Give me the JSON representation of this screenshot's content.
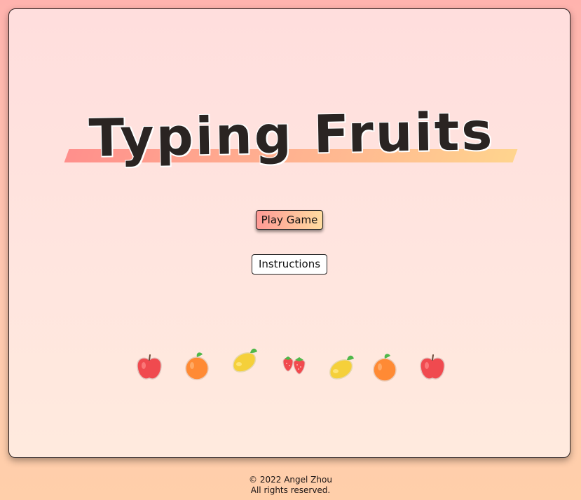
{
  "title": "Typing Fruits",
  "buttons": {
    "play": "Play Game",
    "instructions": "Instructions"
  },
  "fruits": [
    {
      "icon": "apple-icon"
    },
    {
      "icon": "orange-icon"
    },
    {
      "icon": "mango-icon"
    },
    {
      "icon": "strawberry-icon"
    },
    {
      "icon": "mango-icon"
    },
    {
      "icon": "orange-icon"
    },
    {
      "icon": "apple-icon"
    }
  ],
  "footer": {
    "copyright": "© 2022 Angel Zhou",
    "rights": "All rights reserved."
  },
  "colors": {
    "title_stripe_start": "#ff8f8c",
    "title_stripe_end": "#ffd48e",
    "play_button_start": "#ff9a96",
    "play_button_end": "#ffdca0"
  }
}
